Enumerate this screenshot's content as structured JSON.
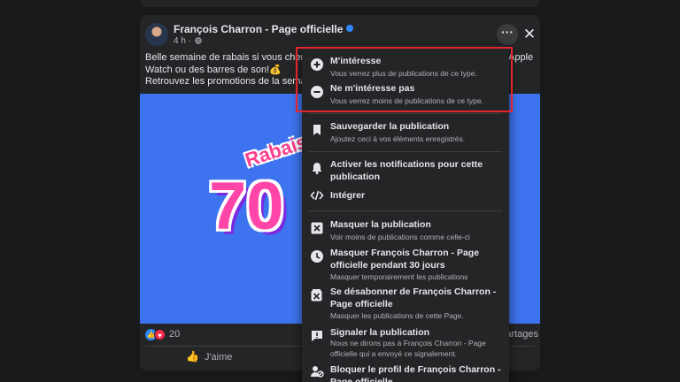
{
  "post": {
    "author": "François Charron - Page officielle",
    "meta": "4 h ·",
    "text_lines": [
      "Belle semaine de rabais si vous cherche",
      "Watch ou des barres de son!💰",
      "Retrouvez les promotions de la semaine"
    ],
    "text_right_fragment": "Apple",
    "image_text": {
      "word": "Rabais",
      "number": "70"
    },
    "reaction_count": "20",
    "shares_label": "artages",
    "like_label": "J'aime"
  },
  "menu": {
    "items": [
      {
        "title": "M'intéresse",
        "subtitle": "Vous verrez plus de publications de ce type.",
        "icon": "plus-circle-icon"
      },
      {
        "title": "Ne m'intéresse pas",
        "subtitle": "Vous verrez moins de publications de ce type.",
        "icon": "minus-circle-icon"
      },
      {
        "title": "Sauvegarder la publication",
        "subtitle": "Ajoutez ceci à vos éléments enregistrés.",
        "icon": "bookmark-icon"
      },
      {
        "title": "Activer les notifications pour cette publication",
        "subtitle": "",
        "icon": "bell-icon"
      },
      {
        "title": "Intégrer",
        "subtitle": "",
        "icon": "code-icon"
      },
      {
        "title": "Masquer la publication",
        "subtitle": "Voir moins de publications comme celle-ci",
        "icon": "hide-box-icon"
      },
      {
        "title": "Masquer François Charron - Page officielle pendant 30 jours",
        "subtitle": "Masquer temporairement les publications",
        "icon": "clock-icon"
      },
      {
        "title": "Se désabonner de François Charron - Page officielle",
        "subtitle": "Masquer les publications de cette Page.",
        "icon": "unfollow-icon"
      },
      {
        "title": "Signaler la publication",
        "subtitle": "Nous ne dirons pas à François Charron - Page officielle qui a envoyé ce signalement.",
        "icon": "report-icon"
      },
      {
        "title": "Bloquer le profil de François Charron - Page officielle",
        "subtitle": "",
        "icon": "block-profile-icon"
      }
    ]
  },
  "colors": {
    "background": "#18191a",
    "card": "#242526",
    "image_bg": "#3d73ee",
    "highlight": "#e3262c",
    "verified": "#2d88ff"
  }
}
